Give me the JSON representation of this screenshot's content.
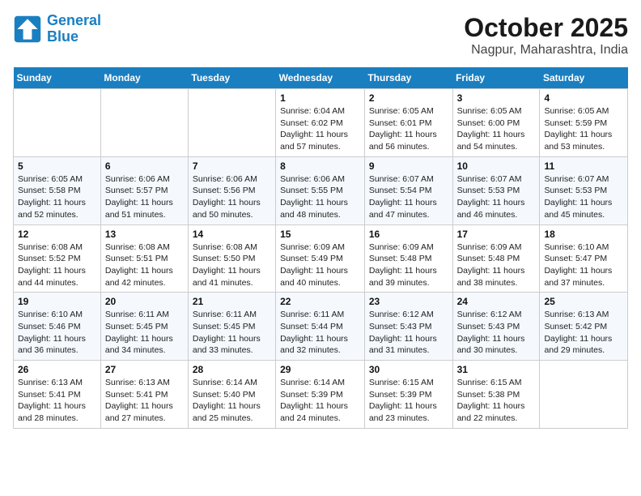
{
  "header": {
    "logo_line1": "General",
    "logo_line2": "Blue",
    "month": "October 2025",
    "location": "Nagpur, Maharashtra, India"
  },
  "weekdays": [
    "Sunday",
    "Monday",
    "Tuesday",
    "Wednesday",
    "Thursday",
    "Friday",
    "Saturday"
  ],
  "weeks": [
    [
      {
        "day": "",
        "sunrise": "",
        "sunset": "",
        "daylight": ""
      },
      {
        "day": "",
        "sunrise": "",
        "sunset": "",
        "daylight": ""
      },
      {
        "day": "",
        "sunrise": "",
        "sunset": "",
        "daylight": ""
      },
      {
        "day": "1",
        "sunrise": "Sunrise: 6:04 AM",
        "sunset": "Sunset: 6:02 PM",
        "daylight": "Daylight: 11 hours and 57 minutes."
      },
      {
        "day": "2",
        "sunrise": "Sunrise: 6:05 AM",
        "sunset": "Sunset: 6:01 PM",
        "daylight": "Daylight: 11 hours and 56 minutes."
      },
      {
        "day": "3",
        "sunrise": "Sunrise: 6:05 AM",
        "sunset": "Sunset: 6:00 PM",
        "daylight": "Daylight: 11 hours and 54 minutes."
      },
      {
        "day": "4",
        "sunrise": "Sunrise: 6:05 AM",
        "sunset": "Sunset: 5:59 PM",
        "daylight": "Daylight: 11 hours and 53 minutes."
      }
    ],
    [
      {
        "day": "5",
        "sunrise": "Sunrise: 6:05 AM",
        "sunset": "Sunset: 5:58 PM",
        "daylight": "Daylight: 11 hours and 52 minutes."
      },
      {
        "day": "6",
        "sunrise": "Sunrise: 6:06 AM",
        "sunset": "Sunset: 5:57 PM",
        "daylight": "Daylight: 11 hours and 51 minutes."
      },
      {
        "day": "7",
        "sunrise": "Sunrise: 6:06 AM",
        "sunset": "Sunset: 5:56 PM",
        "daylight": "Daylight: 11 hours and 50 minutes."
      },
      {
        "day": "8",
        "sunrise": "Sunrise: 6:06 AM",
        "sunset": "Sunset: 5:55 PM",
        "daylight": "Daylight: 11 hours and 48 minutes."
      },
      {
        "day": "9",
        "sunrise": "Sunrise: 6:07 AM",
        "sunset": "Sunset: 5:54 PM",
        "daylight": "Daylight: 11 hours and 47 minutes."
      },
      {
        "day": "10",
        "sunrise": "Sunrise: 6:07 AM",
        "sunset": "Sunset: 5:53 PM",
        "daylight": "Daylight: 11 hours and 46 minutes."
      },
      {
        "day": "11",
        "sunrise": "Sunrise: 6:07 AM",
        "sunset": "Sunset: 5:53 PM",
        "daylight": "Daylight: 11 hours and 45 minutes."
      }
    ],
    [
      {
        "day": "12",
        "sunrise": "Sunrise: 6:08 AM",
        "sunset": "Sunset: 5:52 PM",
        "daylight": "Daylight: 11 hours and 44 minutes."
      },
      {
        "day": "13",
        "sunrise": "Sunrise: 6:08 AM",
        "sunset": "Sunset: 5:51 PM",
        "daylight": "Daylight: 11 hours and 42 minutes."
      },
      {
        "day": "14",
        "sunrise": "Sunrise: 6:08 AM",
        "sunset": "Sunset: 5:50 PM",
        "daylight": "Daylight: 11 hours and 41 minutes."
      },
      {
        "day": "15",
        "sunrise": "Sunrise: 6:09 AM",
        "sunset": "Sunset: 5:49 PM",
        "daylight": "Daylight: 11 hours and 40 minutes."
      },
      {
        "day": "16",
        "sunrise": "Sunrise: 6:09 AM",
        "sunset": "Sunset: 5:48 PM",
        "daylight": "Daylight: 11 hours and 39 minutes."
      },
      {
        "day": "17",
        "sunrise": "Sunrise: 6:09 AM",
        "sunset": "Sunset: 5:48 PM",
        "daylight": "Daylight: 11 hours and 38 minutes."
      },
      {
        "day": "18",
        "sunrise": "Sunrise: 6:10 AM",
        "sunset": "Sunset: 5:47 PM",
        "daylight": "Daylight: 11 hours and 37 minutes."
      }
    ],
    [
      {
        "day": "19",
        "sunrise": "Sunrise: 6:10 AM",
        "sunset": "Sunset: 5:46 PM",
        "daylight": "Daylight: 11 hours and 36 minutes."
      },
      {
        "day": "20",
        "sunrise": "Sunrise: 6:11 AM",
        "sunset": "Sunset: 5:45 PM",
        "daylight": "Daylight: 11 hours and 34 minutes."
      },
      {
        "day": "21",
        "sunrise": "Sunrise: 6:11 AM",
        "sunset": "Sunset: 5:45 PM",
        "daylight": "Daylight: 11 hours and 33 minutes."
      },
      {
        "day": "22",
        "sunrise": "Sunrise: 6:11 AM",
        "sunset": "Sunset: 5:44 PM",
        "daylight": "Daylight: 11 hours and 32 minutes."
      },
      {
        "day": "23",
        "sunrise": "Sunrise: 6:12 AM",
        "sunset": "Sunset: 5:43 PM",
        "daylight": "Daylight: 11 hours and 31 minutes."
      },
      {
        "day": "24",
        "sunrise": "Sunrise: 6:12 AM",
        "sunset": "Sunset: 5:43 PM",
        "daylight": "Daylight: 11 hours and 30 minutes."
      },
      {
        "day": "25",
        "sunrise": "Sunrise: 6:13 AM",
        "sunset": "Sunset: 5:42 PM",
        "daylight": "Daylight: 11 hours and 29 minutes."
      }
    ],
    [
      {
        "day": "26",
        "sunrise": "Sunrise: 6:13 AM",
        "sunset": "Sunset: 5:41 PM",
        "daylight": "Daylight: 11 hours and 28 minutes."
      },
      {
        "day": "27",
        "sunrise": "Sunrise: 6:13 AM",
        "sunset": "Sunset: 5:41 PM",
        "daylight": "Daylight: 11 hours and 27 minutes."
      },
      {
        "day": "28",
        "sunrise": "Sunrise: 6:14 AM",
        "sunset": "Sunset: 5:40 PM",
        "daylight": "Daylight: 11 hours and 25 minutes."
      },
      {
        "day": "29",
        "sunrise": "Sunrise: 6:14 AM",
        "sunset": "Sunset: 5:39 PM",
        "daylight": "Daylight: 11 hours and 24 minutes."
      },
      {
        "day": "30",
        "sunrise": "Sunrise: 6:15 AM",
        "sunset": "Sunset: 5:39 PM",
        "daylight": "Daylight: 11 hours and 23 minutes."
      },
      {
        "day": "31",
        "sunrise": "Sunrise: 6:15 AM",
        "sunset": "Sunset: 5:38 PM",
        "daylight": "Daylight: 11 hours and 22 minutes."
      },
      {
        "day": "",
        "sunrise": "",
        "sunset": "",
        "daylight": ""
      }
    ]
  ]
}
